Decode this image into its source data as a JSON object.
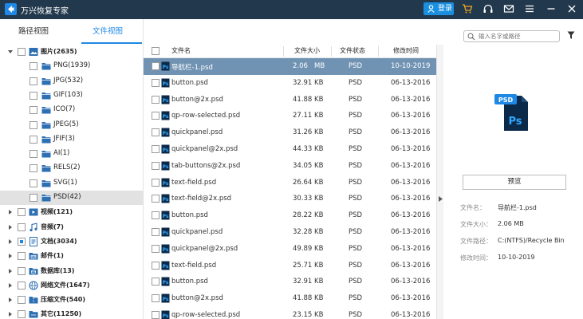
{
  "app": {
    "title": "万兴恢复专家",
    "login_label": "登录"
  },
  "tabs": {
    "path_view": "路径视图",
    "file_view": "文件视图"
  },
  "tree": [
    {
      "label": "图片(2635)",
      "level": 0,
      "expanded": true,
      "checked": "none",
      "icon": "image-folder-icon"
    },
    {
      "label": "PNG(1939)",
      "level": 1,
      "icon": "folder-icon"
    },
    {
      "label": "JPG(532)",
      "level": 1,
      "icon": "folder-icon"
    },
    {
      "label": "GIF(103)",
      "level": 1,
      "icon": "folder-icon"
    },
    {
      "label": "ICO(7)",
      "level": 1,
      "icon": "folder-icon"
    },
    {
      "label": "JPEG(5)",
      "level": 1,
      "icon": "folder-icon"
    },
    {
      "label": "JFIF(3)",
      "level": 1,
      "icon": "folder-icon"
    },
    {
      "label": "AI(1)",
      "level": 1,
      "icon": "folder-icon"
    },
    {
      "label": "RELS(2)",
      "level": 1,
      "icon": "folder-icon"
    },
    {
      "label": "SVG(1)",
      "level": 1,
      "icon": "folder-icon"
    },
    {
      "label": "PSD(42)",
      "level": 1,
      "icon": "folder-icon",
      "selected": true
    },
    {
      "label": "视频(121)",
      "level": 0,
      "icon": "video-icon"
    },
    {
      "label": "音频(7)",
      "level": 0,
      "icon": "music-icon"
    },
    {
      "label": "文档(3034)",
      "level": 0,
      "icon": "document-icon",
      "checked": "partial"
    },
    {
      "label": "邮件(1)",
      "level": 0,
      "icon": "mail-folder-icon"
    },
    {
      "label": "数据库(13)",
      "level": 0,
      "icon": "database-folder-icon"
    },
    {
      "label": "网络文件(1647)",
      "level": 0,
      "icon": "globe-icon"
    },
    {
      "label": "压缩文件(540)",
      "level": 0,
      "icon": "archive-folder-icon"
    },
    {
      "label": "其它(11250)",
      "level": 0,
      "icon": "other-folder-icon"
    }
  ],
  "table": {
    "headers": {
      "name": "文件名",
      "size": "文件大小",
      "status": "文件状态",
      "date": "修改时间"
    },
    "rows": [
      {
        "name": "导航栏-1.psd",
        "size": "2.06",
        "unit": "MB",
        "status": "PSD",
        "date": "10-10-2019",
        "selected": true
      },
      {
        "name": "button.psd",
        "size": "32.91",
        "unit": "KB",
        "status": "PSD",
        "date": "06-13-2016"
      },
      {
        "name": "button@2x.psd",
        "size": "41.88",
        "unit": "KB",
        "status": "PSD",
        "date": "06-13-2016"
      },
      {
        "name": "qp-row-selected.psd",
        "size": "27.11",
        "unit": "KB",
        "status": "PSD",
        "date": "06-13-2016"
      },
      {
        "name": "quickpanel.psd",
        "size": "31.26",
        "unit": "KB",
        "status": "PSD",
        "date": "06-13-2016"
      },
      {
        "name": "quickpanel@2x.psd",
        "size": "44.33",
        "unit": "KB",
        "status": "PSD",
        "date": "06-13-2016"
      },
      {
        "name": "tab-buttons@2x.psd",
        "size": "34.05",
        "unit": "KB",
        "status": "PSD",
        "date": "06-13-2016"
      },
      {
        "name": "text-field.psd",
        "size": "26.64",
        "unit": "KB",
        "status": "PSD",
        "date": "06-13-2016"
      },
      {
        "name": "text-field@2x.psd",
        "size": "30.33",
        "unit": "KB",
        "status": "PSD",
        "date": "06-13-2016"
      },
      {
        "name": "button.psd",
        "size": "28.22",
        "unit": "KB",
        "status": "PSD",
        "date": "06-13-2016"
      },
      {
        "name": "quickpanel.psd",
        "size": "32.28",
        "unit": "KB",
        "status": "PSD",
        "date": "06-13-2016"
      },
      {
        "name": "quickpanel@2x.psd",
        "size": "49.89",
        "unit": "KB",
        "status": "PSD",
        "date": "06-13-2016"
      },
      {
        "name": "text-field.psd",
        "size": "25.71",
        "unit": "KB",
        "status": "PSD",
        "date": "06-13-2016"
      },
      {
        "name": "button.psd",
        "size": "32.91",
        "unit": "KB",
        "status": "PSD",
        "date": "06-13-2016"
      },
      {
        "name": "button@2x.psd",
        "size": "41.88",
        "unit": "KB",
        "status": "PSD",
        "date": "06-13-2016"
      },
      {
        "name": "qp-row-selected.psd",
        "size": "23.15",
        "unit": "KB",
        "status": "PSD",
        "date": "06-13-2016"
      }
    ]
  },
  "search": {
    "placeholder": "输入名字或路径"
  },
  "preview": {
    "icon_label": "PSD",
    "icon_letters": "Ps",
    "button_label": "预览",
    "info": [
      {
        "key": "文件名：",
        "value": "导航栏-1.psd"
      },
      {
        "key": "文件大小：",
        "value": "2.06  MB"
      },
      {
        "key": "文件路径：",
        "value": "C:(NTFS)/Recycle Bin"
      },
      {
        "key": "修改时间：",
        "value": "10-10-2019"
      }
    ]
  },
  "colors": {
    "titlebar": "#22384d",
    "accent": "#1f88e5",
    "selected_row": "#7093b3",
    "cart": "#f5a623",
    "ps_blue": "#0b2a4a",
    "ps_text": "#31a8ff"
  }
}
